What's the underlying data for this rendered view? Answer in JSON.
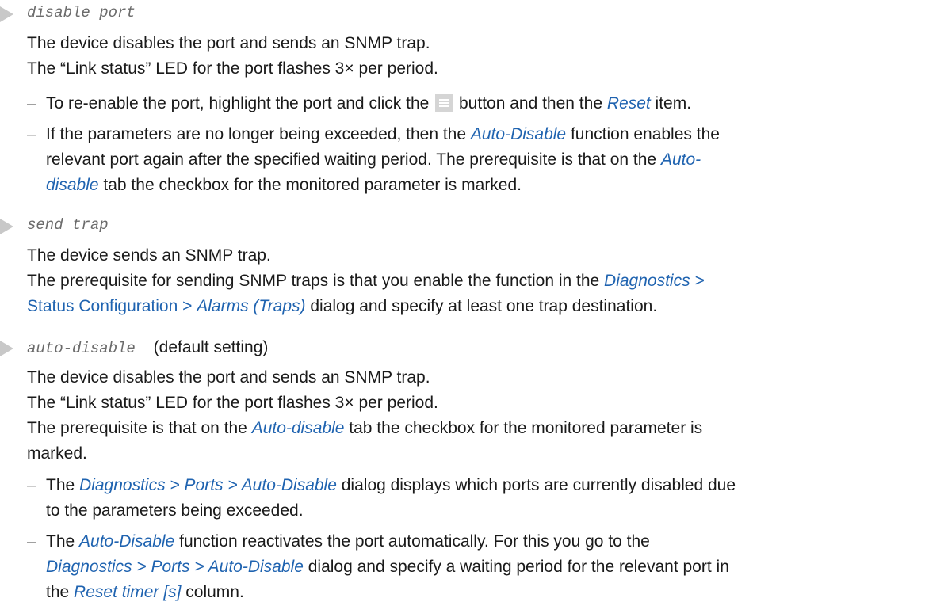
{
  "entries": {
    "disable_port": {
      "code": "disable port",
      "line1": "The device disables the port and sends an SNMP trap.",
      "line2": "The “Link status” LED for the port flashes 3× per period.",
      "sub1": {
        "a": "To re-enable the port, highlight the port and click the",
        "b": "button and then the",
        "c": "Reset",
        "d": "item."
      },
      "sub2": {
        "a": "If the parameters are no longer being exceeded, then the",
        "b": "Auto-Disable",
        "c": "function enables the",
        "d": "relevant port again after the specified waiting period. The prerequisite is that on the",
        "e": "Auto-",
        "f": "disable",
        "g": "tab the checkbox for the monitored parameter is marked."
      }
    },
    "send_trap": {
      "code": "send trap",
      "line1": "The device sends an SNMP trap.",
      "line2a": "The prerequisite for sending SNMP traps is that you enable the function in the",
      "line2b": "Diagnostics >",
      "line3a": "Status Configuration >",
      "line3b": "Alarms (Traps)",
      "line3c": "dialog and specify at least one trap destination."
    },
    "auto_disable": {
      "code": "auto-disable",
      "note": "(default setting)",
      "line1": "The device disables the port and sends an SNMP trap.",
      "line2": "The “Link status” LED for the port flashes 3× per period.",
      "line3a": "The prerequisite is that on the",
      "line3b": "Auto-disable",
      "line3c": "tab the checkbox for the monitored parameter is",
      "line4": "marked.",
      "sub1": {
        "a": "The",
        "b": "Diagnostics > Ports > Auto-Disable",
        "c": "dialog displays which ports are currently disabled due",
        "d": "to the parameters being exceeded."
      },
      "sub2": {
        "a": "The",
        "b": "Auto-Disable",
        "c": "function reactivates the port automatically. For this you go to the",
        "d": "Diagnostics > Ports > Auto-Disable",
        "e": "dialog and specify a waiting period for the relevant port in",
        "f": "the",
        "g": "Reset timer [s]",
        "h": "column."
      }
    }
  },
  "dash_char": "–",
  "icons": {
    "bullet": "triangle-bullet-icon",
    "menu": "menu-button-icon"
  },
  "colors": {
    "link": "#1f63b0",
    "bullet": "#c8c8c8",
    "code": "#6b6b6b"
  }
}
